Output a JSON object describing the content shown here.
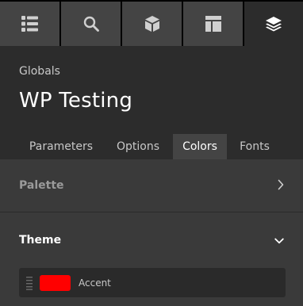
{
  "toolbar": {
    "tools": [
      {
        "icon": "list-icon"
      },
      {
        "icon": "search-icon"
      },
      {
        "icon": "cube-icon"
      },
      {
        "icon": "layout-icon"
      },
      {
        "icon": "layers-icon",
        "active": true
      }
    ]
  },
  "header": {
    "breadcrumb": "Globals",
    "title": "WP Testing"
  },
  "tabs": [
    {
      "label": "Parameters"
    },
    {
      "label": "Options"
    },
    {
      "label": "Colors",
      "active": true
    },
    {
      "label": "Fonts"
    }
  ],
  "sections": {
    "palette": {
      "label": "Palette",
      "icon": "chevron-right-icon"
    },
    "theme": {
      "label": "Theme",
      "icon": "chevron-down-icon"
    }
  },
  "theme_colors": [
    {
      "name": "Accent",
      "color": "#ff0000",
      "handle_icon": "drag-handle-icon"
    }
  ],
  "colors": {
    "background": "#2c2c2c",
    "toolbar": "#444444",
    "active_tab": "#444444",
    "accent_swatch": "#ff0000"
  }
}
